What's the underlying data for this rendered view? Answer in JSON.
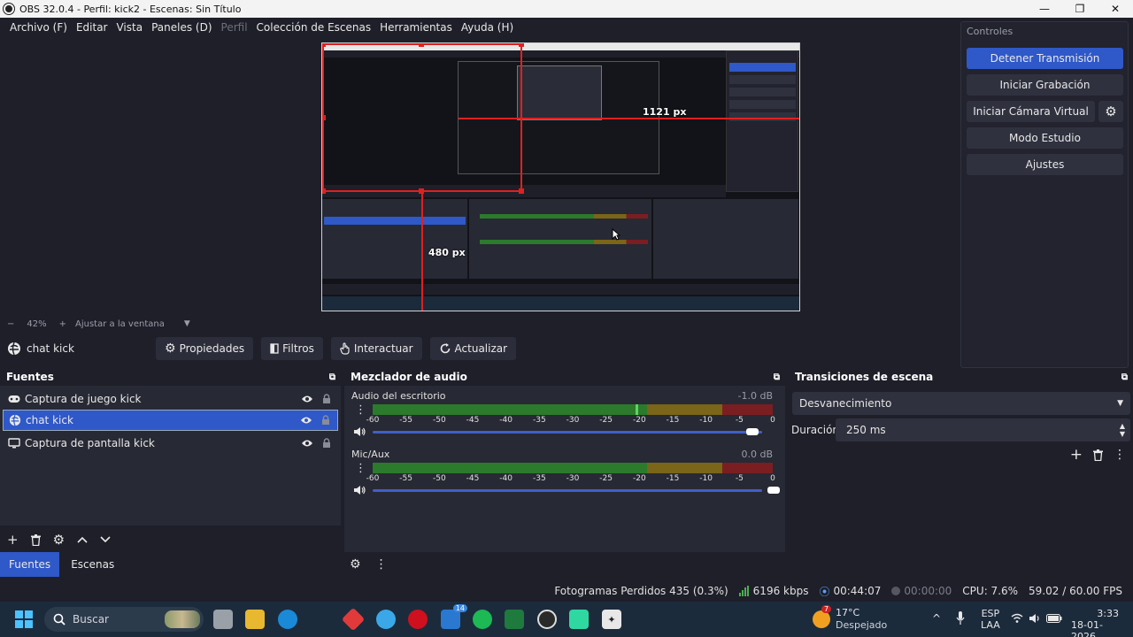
{
  "window": {
    "title": "OBS 32.0.4 - Perfil: kick2 - Escenas: Sin Título"
  },
  "menu": {
    "items": [
      "Archivo (F)",
      "Editar",
      "Vista",
      "Paneles (D)",
      "Perfil",
      "Colección de Escenas",
      "Herramientas",
      "Ayuda (H)"
    ]
  },
  "preview": {
    "width_label": "1121 px",
    "height_label": "480 px"
  },
  "zoom": {
    "minus": "−",
    "value": "42%",
    "plus": "+",
    "fit_label": "Ajustar a la ventana"
  },
  "source_toolbar": {
    "selected_source": "chat kick",
    "properties_label": "Propiedades",
    "filters_label": "Filtros",
    "interact_label": "Interactuar",
    "refresh_label": "Actualizar"
  },
  "controls": {
    "title": "Controles",
    "stop_stream": "Detener Transmisión",
    "start_recording": "Iniciar Grabación",
    "start_virtual_cam": "Iniciar Cámara Virtual",
    "studio_mode": "Modo Estudio",
    "settings": "Ajustes"
  },
  "sources": {
    "title": "Fuentes",
    "items": [
      {
        "name": "Captura de juego kick",
        "icon": "gamepad-icon",
        "selected": false
      },
      {
        "name": "chat kick",
        "icon": "browser-icon",
        "selected": true
      },
      {
        "name": "Captura de pantalla kick",
        "icon": "monitor-icon",
        "selected": false
      }
    ]
  },
  "mixer": {
    "title": "Mezclador de audio",
    "ticks": [
      "-60",
      "-55",
      "-50",
      "-45",
      "-40",
      "-35",
      "-30",
      "-25",
      "-20",
      "-15",
      "-10",
      "-5",
      "0"
    ],
    "channels": [
      {
        "name": "Audio del escritorio",
        "db": "-1.0 dB",
        "level": 0.95
      },
      {
        "name": "Mic/Aux",
        "db": "0.0 dB",
        "level": 1.0
      }
    ]
  },
  "transitions": {
    "title": "Transiciones de escena",
    "selected": "Desvanecimiento",
    "duration_label": "Duración",
    "duration_value": "250 ms"
  },
  "tabs": [
    "Fuentes",
    "Escenas"
  ],
  "status": {
    "dropped_frames": "Fotogramas Perdidos 435 (0.3%)",
    "bitrate": "6196 kbps",
    "stream_time": "00:44:07",
    "record_time": "00:00:00",
    "cpu": "CPU: 7.6%",
    "fps": "59.02 / 60.00 FPS"
  },
  "taskbar": {
    "search_placeholder": "Buscar",
    "weather_temp": "17°C",
    "weather_desc": "Despejado",
    "weather_badge": "7",
    "mail_badge": "14",
    "lang_top": "ESP",
    "lang_bottom": "LAA",
    "time": "3:33",
    "date": "18-01-2026"
  },
  "colors": {
    "accent": "#2f58c8",
    "bg": "#1e1f29",
    "selection_red": "#e02020"
  }
}
